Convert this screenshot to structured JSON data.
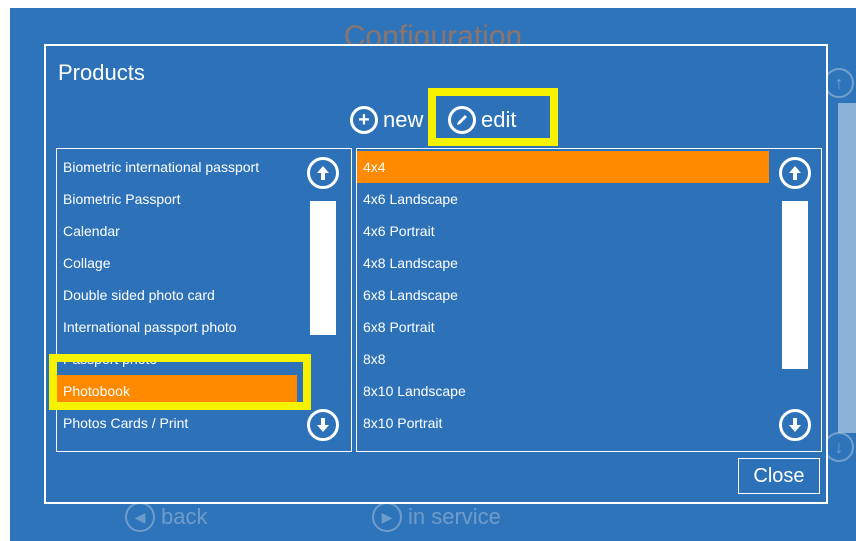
{
  "background": {
    "title": "Configuration",
    "back_label": "back",
    "in_service_label": "in service"
  },
  "dialog": {
    "title": "Products",
    "new_label": "new",
    "edit_label": "edit",
    "close_label": "Close"
  },
  "categories": {
    "items": [
      "Biometric international passport",
      "Biometric Passport",
      "Calendar",
      "Collage",
      "Double sided photo card",
      "International passport photo",
      "Passport photo",
      "Photobook",
      "Photos Cards / Print"
    ],
    "selected": "Photobook"
  },
  "sizes": {
    "items": [
      "4x4",
      "4x6 Landscape",
      "4x6 Portrait",
      "4x8 Landscape",
      "6x8 Landscape",
      "6x8 Portrait",
      "8x8",
      "8x10 Landscape",
      "8x10 Portrait"
    ],
    "selected": "4x4"
  },
  "colors": {
    "background": "#2e74ba",
    "selection": "#ff8a00",
    "highlight": "#f7f200",
    "text": "#ffffff"
  }
}
